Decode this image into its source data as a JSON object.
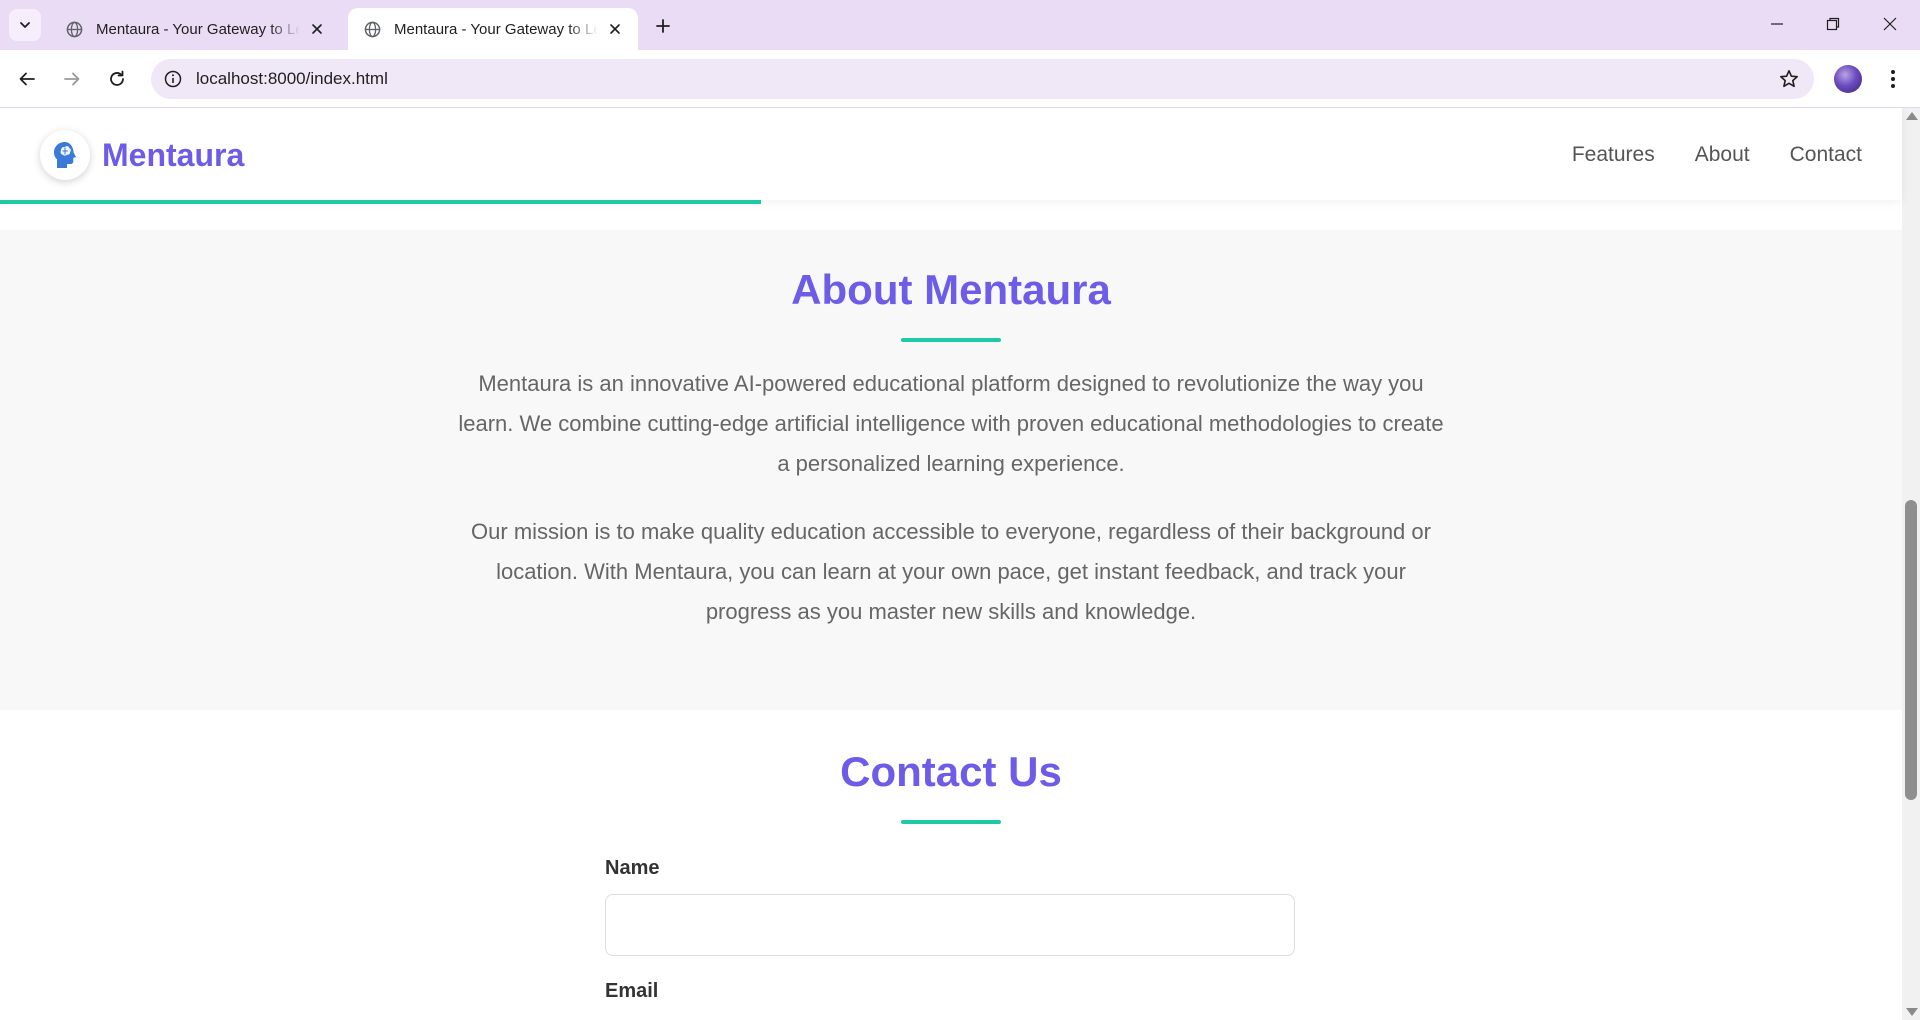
{
  "browser": {
    "tabs": [
      {
        "title": "Mentaura - Your Gateway to Learning",
        "active": false
      },
      {
        "title": "Mentaura - Your Gateway to Learning",
        "active": true
      }
    ],
    "url": "localhost:8000/index.html"
  },
  "site": {
    "brand": "Mentaura",
    "nav": [
      "Features",
      "About",
      "Contact"
    ],
    "read_progress": 0.4
  },
  "about": {
    "title": "About Mentaura",
    "paragraphs": [
      "Mentaura is an innovative AI-powered educational platform designed to revolutionize the way you learn. We combine cutting-edge artificial intelligence with proven educational methodologies to create a personalized learning experience.",
      "Our mission is to make quality education accessible to everyone, regardless of their background or location. With Mentaura, you can learn at your own pace, get instant feedback, and track your progress as you master new skills and knowledge."
    ]
  },
  "contact": {
    "title": "Contact Us",
    "fields": [
      {
        "label": "Name",
        "value": ""
      },
      {
        "label": "Email",
        "value": ""
      }
    ]
  },
  "colors": {
    "brand_purple": "#6c5ce7",
    "accent_teal": "#1ec9a8",
    "chrome_lavender": "#e9dcf4"
  },
  "icons": [
    "tab-search-icon",
    "globe-icon",
    "close-icon",
    "plus-icon",
    "minimize-icon",
    "restore-icon",
    "back-arrow-icon",
    "forward-arrow-icon",
    "reload-icon",
    "site-info-icon",
    "bookmark-star-icon",
    "profile-avatar",
    "more-menu-icon",
    "brain-head-icon"
  ]
}
